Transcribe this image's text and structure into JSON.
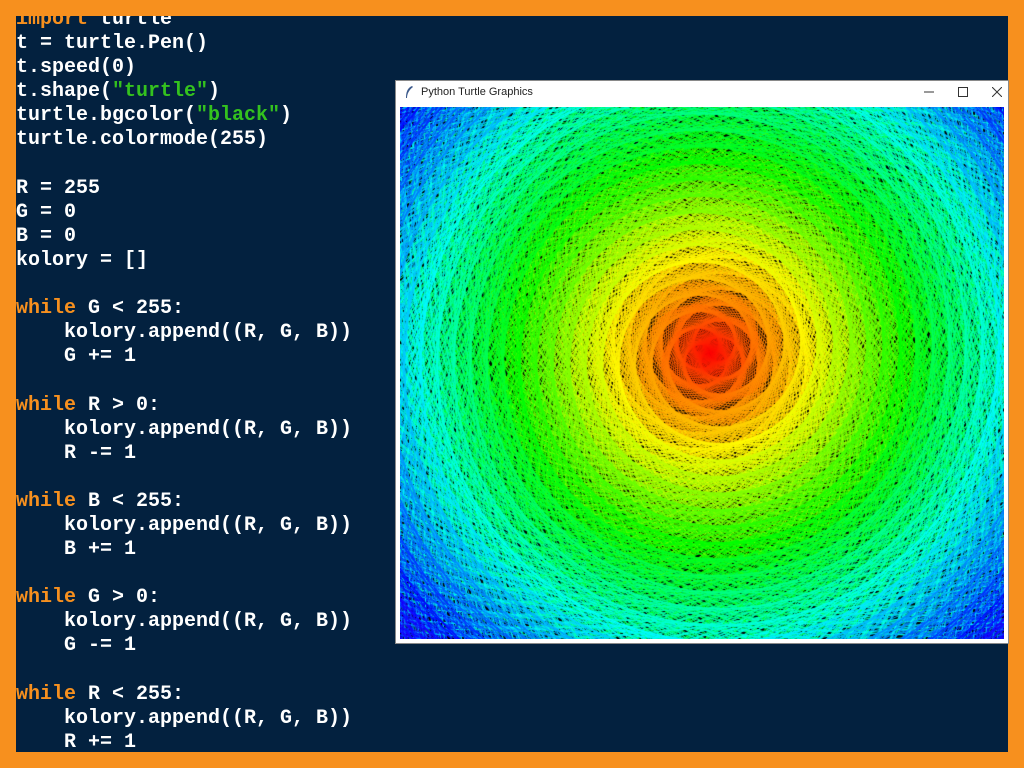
{
  "code_lines": [
    [
      {
        "t": "import",
        "c": "kw"
      },
      {
        "t": " turtle"
      }
    ],
    [
      {
        "t": "t = turtle.Pen()"
      }
    ],
    [
      {
        "t": "t.speed(0)"
      }
    ],
    [
      {
        "t": "t.shape("
      },
      {
        "t": "\"turtle\"",
        "c": "str"
      },
      {
        "t": ")"
      }
    ],
    [
      {
        "t": "turtle.bgcolor("
      },
      {
        "t": "\"black\"",
        "c": "str"
      },
      {
        "t": ")"
      }
    ],
    [
      {
        "t": "turtle.colormode(255)"
      }
    ],
    [
      {
        "t": ""
      }
    ],
    [
      {
        "t": "R = 255"
      }
    ],
    [
      {
        "t": "G = 0"
      }
    ],
    [
      {
        "t": "B = 0"
      }
    ],
    [
      {
        "t": "kolory = []"
      }
    ],
    [
      {
        "t": ""
      }
    ],
    [
      {
        "t": "while",
        "c": "kw"
      },
      {
        "t": " G < 255:"
      }
    ],
    [
      {
        "t": "    kolory.append((R, G, B))"
      }
    ],
    [
      {
        "t": "    G += 1"
      }
    ],
    [
      {
        "t": ""
      }
    ],
    [
      {
        "t": "while",
        "c": "kw"
      },
      {
        "t": " R > 0:"
      }
    ],
    [
      {
        "t": "    kolory.append((R, G, B))"
      }
    ],
    [
      {
        "t": "    R -= 1"
      }
    ],
    [
      {
        "t": ""
      }
    ],
    [
      {
        "t": "while",
        "c": "kw"
      },
      {
        "t": " B < 255:"
      }
    ],
    [
      {
        "t": "    kolory.append((R, G, B))"
      }
    ],
    [
      {
        "t": "    B += 1"
      }
    ],
    [
      {
        "t": ""
      }
    ],
    [
      {
        "t": "while",
        "c": "kw"
      },
      {
        "t": " G > 0:"
      }
    ],
    [
      {
        "t": "    kolory.append((R, G, B))"
      }
    ],
    [
      {
        "t": "    G -= 1"
      }
    ],
    [
      {
        "t": ""
      }
    ],
    [
      {
        "t": "while",
        "c": "kw"
      },
      {
        "t": " R < 255:"
      }
    ],
    [
      {
        "t": "    kolory.append((R, G, B))"
      }
    ],
    [
      {
        "t": "    R += 1"
      }
    ]
  ],
  "window": {
    "title": "Python Turtle Graphics",
    "icon": "feather-icon",
    "controls": [
      "minimize-icon",
      "maximize-icon",
      "close-icon"
    ]
  },
  "colors": {
    "frame": "#f7901e",
    "editor_background": "#03213f",
    "code_text": "#ffffff",
    "keyword": "#f7901e",
    "string": "#34c21e",
    "canvas_background": "#000000"
  }
}
